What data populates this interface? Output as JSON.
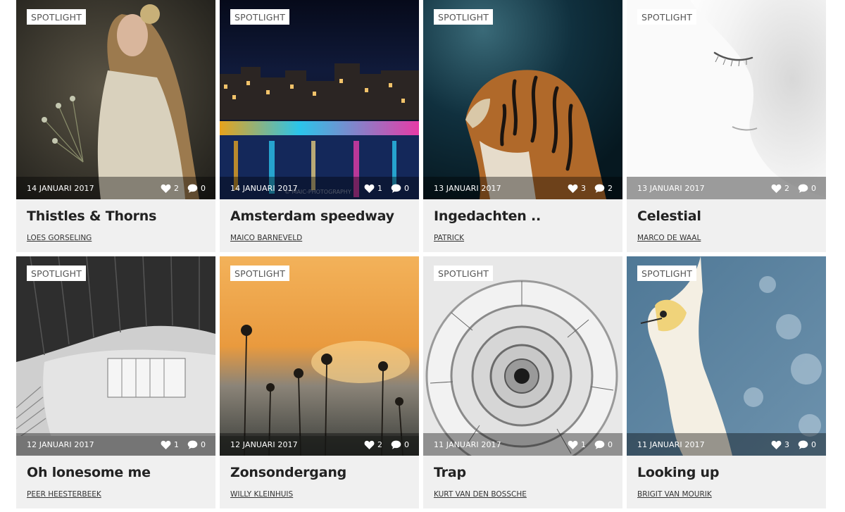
{
  "badge_label": "SPOTLIGHT",
  "cards": [
    {
      "date": "14 JANUARI 2017",
      "likes": "2",
      "comments": "0",
      "title": "Thistles & Thorns",
      "author": "LOES GORSELING"
    },
    {
      "date": "14 JANUARI 2017",
      "likes": "1",
      "comments": "0",
      "title": "Amsterdam speedway",
      "author": "MAICO BARNEVELD",
      "watermark": "© MAIC-PHOTOGRAPHY"
    },
    {
      "date": "13 JANUARI 2017",
      "likes": "3",
      "comments": "2",
      "title": "Ingedachten ..",
      "author": "PATRICK"
    },
    {
      "date": "13 JANUARI 2017",
      "likes": "2",
      "comments": "0",
      "title": "Celestial",
      "author": "MARCO DE WAAL"
    },
    {
      "date": "12 JANUARI 2017",
      "likes": "1",
      "comments": "0",
      "title": "Oh lonesome me",
      "author": "PEER HEESTERBEEK"
    },
    {
      "date": "12 JANUARI 2017",
      "likes": "2",
      "comments": "0",
      "title": "Zonsondergang",
      "author": "WILLY KLEINHUIS"
    },
    {
      "date": "11 JANUARI 2017",
      "likes": "1",
      "comments": "0",
      "title": "Trap",
      "author": "KURT VAN DEN BOSSCHE"
    },
    {
      "date": "11 JANUARI 2017",
      "likes": "3",
      "comments": "0",
      "title": "Looking up",
      "author": "BRIGIT VAN MOURIK"
    }
  ],
  "icons": {
    "likes": "heart-icon",
    "comments": "comment-bubble-icon"
  },
  "colors": {
    "card_bg": "#f0f0f0",
    "title": "#222222",
    "meta_overlay": "rgba(0,0,0,0.38)"
  }
}
